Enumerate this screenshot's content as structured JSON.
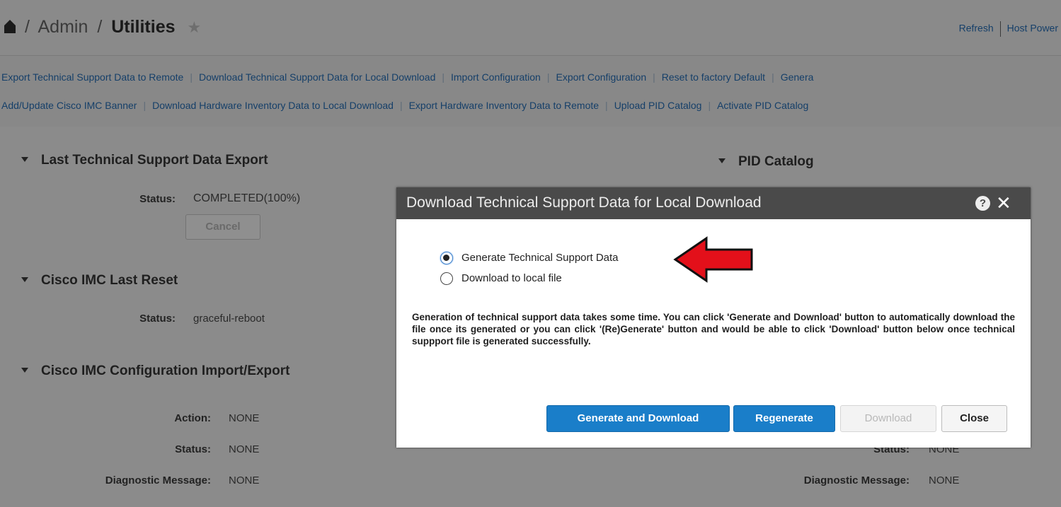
{
  "header": {
    "breadcrumb": [
      "Admin",
      "Utilities"
    ],
    "separator": "/",
    "star": "★",
    "actions": [
      "Refresh",
      "Host Power"
    ]
  },
  "links": {
    "row1": [
      "Export Technical Support Data to Remote",
      "Download Technical Support Data for Local Download",
      "Import Configuration",
      "Export Configuration",
      "Reset to factory Default",
      "Genera"
    ],
    "row2": [
      "Add/Update Cisco IMC Banner",
      "Download Hardware Inventory Data to Local Download",
      "Export Hardware Inventory Data to Remote",
      "Upload PID Catalog",
      "Activate PID Catalog"
    ],
    "separator": "|"
  },
  "sections": {
    "tech_support": {
      "title": "Last Technical Support Data Export",
      "status_label": "Status:",
      "status_value": "COMPLETED(100%)",
      "cancel_label": "Cancel"
    },
    "last_reset": {
      "title": "Cisco IMC Last Reset",
      "status_label": "Status:",
      "status_value": "graceful-reboot"
    },
    "config": {
      "title": "Cisco IMC Configuration Import/Export",
      "action_label": "Action:",
      "action_value": "NONE",
      "status_label": "Status:",
      "status_value": "NONE",
      "diag_label": "Diagnostic Message:",
      "diag_value": "NONE"
    },
    "pid": {
      "title": "PID Catalog",
      "status_label": "Status:",
      "status_value": "NONE",
      "diag_label": "Diagnostic Message:",
      "diag_value": "NONE"
    }
  },
  "modal": {
    "title": "Download Technical Support Data for Local Download",
    "help_icon": "?",
    "close_icon": "✕",
    "options": [
      {
        "label": "Generate Technical Support Data",
        "selected": true
      },
      {
        "label": "Download to local file",
        "selected": false
      }
    ],
    "description": "Generation of technical support data takes some time. You can click 'Generate and Download' button to automatically download the file once its generated or you can click '(Re)Generate' button and would be able to click 'Download' button below once technical suppport file is generated successfully.",
    "buttons": {
      "generate_download": "Generate and Download",
      "regenerate": "Regenerate",
      "download": "Download",
      "close": "Close"
    }
  },
  "colors": {
    "primary_button": "#1a7ec9",
    "arrow": "#e3101a",
    "link": "#153f69"
  }
}
